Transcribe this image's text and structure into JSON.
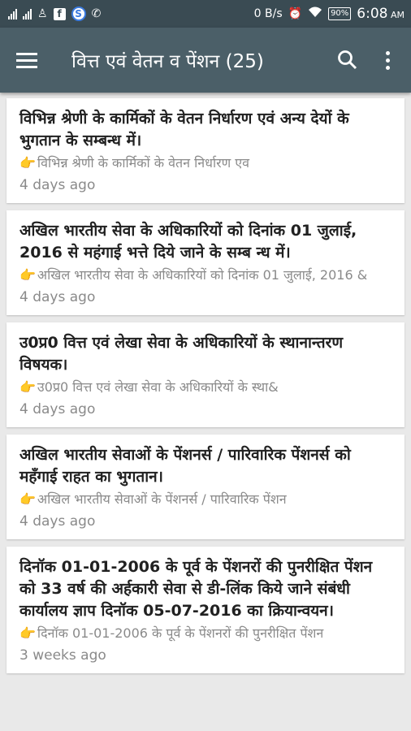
{
  "status_bar": {
    "network_speed": "0 B/s",
    "battery": "90%",
    "time": "6:08",
    "ampm": "AM"
  },
  "appbar": {
    "title": "वित्त एवं वेतन व पेंशन (25)"
  },
  "articles": [
    {
      "title": "विभिन्न श्रेणी के कार्मिकों के वेतन निर्धारण एवं अन्य देयों के भुगतान के सम्बन्ध में।",
      "snippet": "विभिन्न श्रेणी के कार्मिकों के वेतन निर्धारण एव",
      "time": "4 days ago"
    },
    {
      "title": "अखिल भारतीय सेवा के अधिकारियों को दिनांक 01 जुलाई, 2016 से महंगाई भत्ते दिये जाने के सम्ब न्ध में।",
      "snippet": "अखिल भारतीय सेवा के अधिकारियों को दिनांक 01 जुलाई, 2016 &",
      "time": "4 days ago"
    },
    {
      "title": "उ0प्र0 वित्त एवं लेखा सेवा के अधिकारियों के स्थानान्तरण विषयक।",
      "snippet": "उ0प्र0 वित्त एवं लेखा सेवा के अधिकारियों के स्था&",
      "time": "4 days ago"
    },
    {
      "title": "अखिल भारतीय सेवाओं के पेंशनर्स / पारिवारिक पेंशनर्स को महँगाई राहत का भुगतान।",
      "snippet": "अखिल भारतीय सेवाओं के पेंशनर्स / पारिवारिक पेंशन",
      "time": "4 days ago"
    },
    {
      "title": "दिनॉक 01-01-2006 के पूर्व के पेंशनरों की पुनरीक्षित पेंशन को 33 वर्ष की अर्हकारी सेवा से डी-लिंक किये जाने संबंधी कार्यालय ज्ञाप दिनॉक 05-07-2016 का क्रियान्वयन।",
      "snippet": "दिनॉक 01-01-2006 के पूर्व के पेंशनरों की पुनरीक्षित पेंशन",
      "time": "3 weeks ago"
    }
  ]
}
